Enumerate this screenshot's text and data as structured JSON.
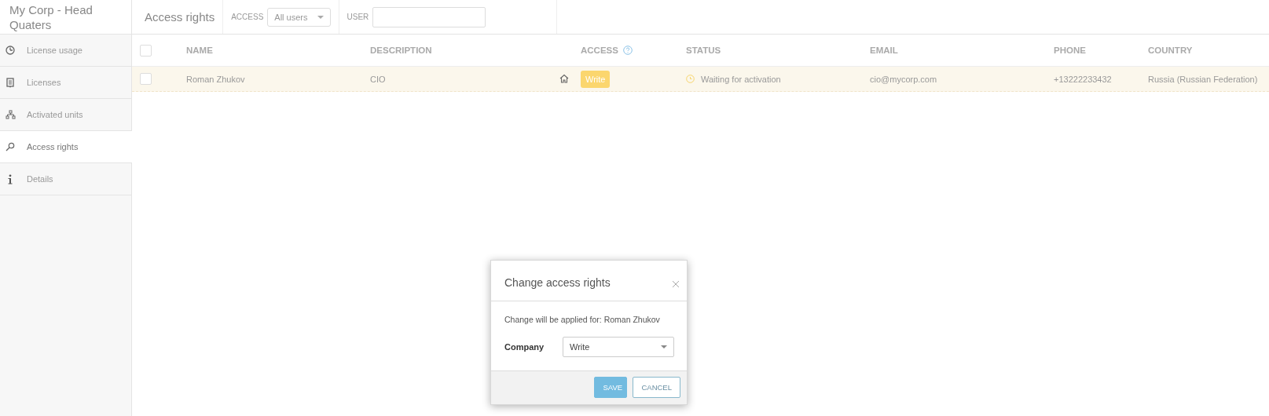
{
  "company_title": "My Corp - Head Quaters",
  "sidebar": {
    "items": [
      {
        "label": "License usage",
        "kind": "usage",
        "selected": false
      },
      {
        "label": "Licenses",
        "kind": "licenses",
        "selected": false
      },
      {
        "label": "Activated units",
        "kind": "units",
        "selected": false
      },
      {
        "label": "Access rights",
        "kind": "key",
        "selected": true
      },
      {
        "label": "Details",
        "kind": "info",
        "selected": false
      }
    ]
  },
  "toolbar": {
    "title": "Access rights",
    "access_filter": {
      "label": "ACCESS",
      "value": "All users"
    },
    "user_filter": {
      "label": "USER"
    }
  },
  "table": {
    "select_all_checked": false,
    "columns": [
      {
        "label": "NAME"
      },
      {
        "label": "DESCRIPTION"
      },
      {
        "label": "ACCESS",
        "help": true
      },
      {
        "label": "STATUS"
      },
      {
        "label": "EMAIL"
      },
      {
        "label": "PHONE"
      },
      {
        "label": "COUNTRY"
      }
    ],
    "rows": [
      {
        "checked": false,
        "name": "Roman Zhukov",
        "description": "CIO",
        "home": true,
        "access": "Write",
        "status": "Waiting for activation",
        "email": "cio@mycorp.com",
        "phone": "+13222233432",
        "country": "Russia (Russian Federation)"
      }
    ]
  },
  "dialog": {
    "title": "Change access rights",
    "message": "Change will be applied for: Roman Zhukov",
    "field_label": "Company",
    "field_value": "Write",
    "buttons": [
      {
        "label": "SAVE",
        "kind": "primary"
      },
      {
        "label": "CANCEL",
        "kind": "secondary"
      }
    ]
  }
}
